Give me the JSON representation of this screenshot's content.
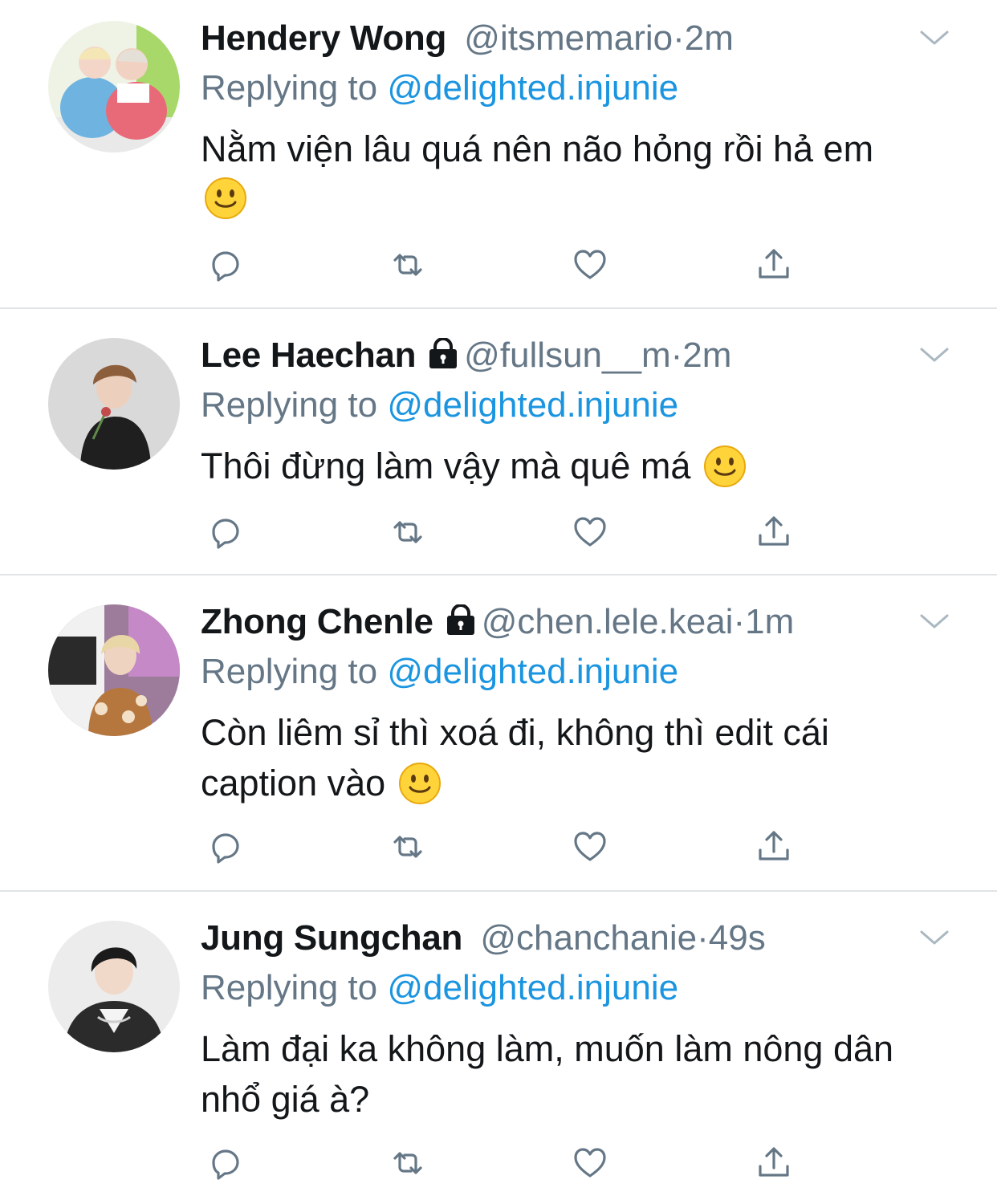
{
  "colors": {
    "text": "#14171a",
    "secondary": "#657786",
    "link": "#1b95e0",
    "divider": "#e1e4e6",
    "icon": "#657786"
  },
  "icons": {
    "reply": "reply-icon",
    "retweet": "retweet-icon",
    "like": "like-icon",
    "share": "share-icon",
    "more": "chevron-down-icon",
    "protected": "lock-icon",
    "emoji": "slightly-smiling-face-emoji"
  },
  "tweets": [
    {
      "name": "Hendery Wong",
      "protected": false,
      "handle": "@itsmemario",
      "separator": "·",
      "time": "2m",
      "reply_prefix": "Replying to",
      "reply_to": "@delighted.injunie",
      "text": "Nằm viện lâu quá nên não hỏng rồi hả em"
    },
    {
      "name": "Lee Haechan",
      "protected": true,
      "handle": "@fullsun__m",
      "separator": "·",
      "time": "2m",
      "reply_prefix": "Replying to",
      "reply_to": "@delighted.injunie",
      "text": "Thôi đừng làm vậy mà quê má"
    },
    {
      "name": "Zhong Chenle",
      "protected": true,
      "handle": "@chen.lele.keai",
      "separator": "·",
      "time": "1m",
      "reply_prefix": "Replying to",
      "reply_to": "@delighted.injunie",
      "text_line1": "Còn liêm sỉ thì xoá đi, không thì edit cái",
      "text_line2": "caption vào"
    },
    {
      "name": "Jung Sungchan",
      "protected": false,
      "handle": "@chanchanie",
      "separator": "·",
      "time": "49s",
      "reply_prefix": "Replying to",
      "reply_to": "@delighted.injunie",
      "text_line1": "Làm đại ka không làm, muốn làm nông dân",
      "text_line2": "nhổ giá à?"
    }
  ]
}
